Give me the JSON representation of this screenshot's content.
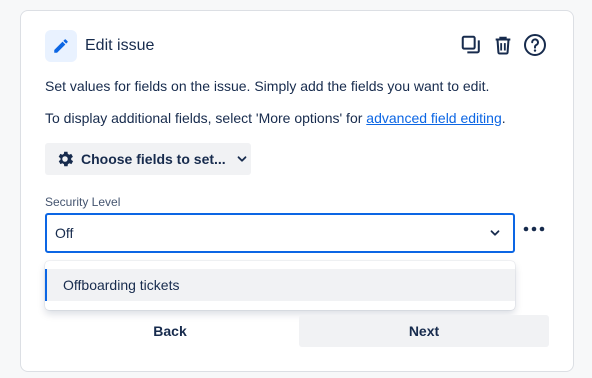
{
  "header": {
    "title": "Edit issue",
    "icon": "pencil-icon",
    "actions": [
      "duplicate-icon",
      "trash-icon",
      "help-icon"
    ]
  },
  "description": {
    "line1": "Set values for fields on the issue. Simply add the fields you want to edit.",
    "line2_prefix": "To display additional fields, select 'More options' for ",
    "line2_link": "advanced field editing",
    "line2_suffix": "."
  },
  "choose_fields": {
    "label": "Choose fields to set...",
    "icon": "gear-icon"
  },
  "security_level": {
    "label": "Security Level",
    "value": "Off",
    "options": [
      "Offboarding tickets"
    ]
  },
  "footer": {
    "back_label": "Back",
    "next_label": "Next"
  },
  "colors": {
    "accent": "#0c66e4",
    "text": "#172b4d",
    "subtle_bg": "#f1f2f4"
  }
}
